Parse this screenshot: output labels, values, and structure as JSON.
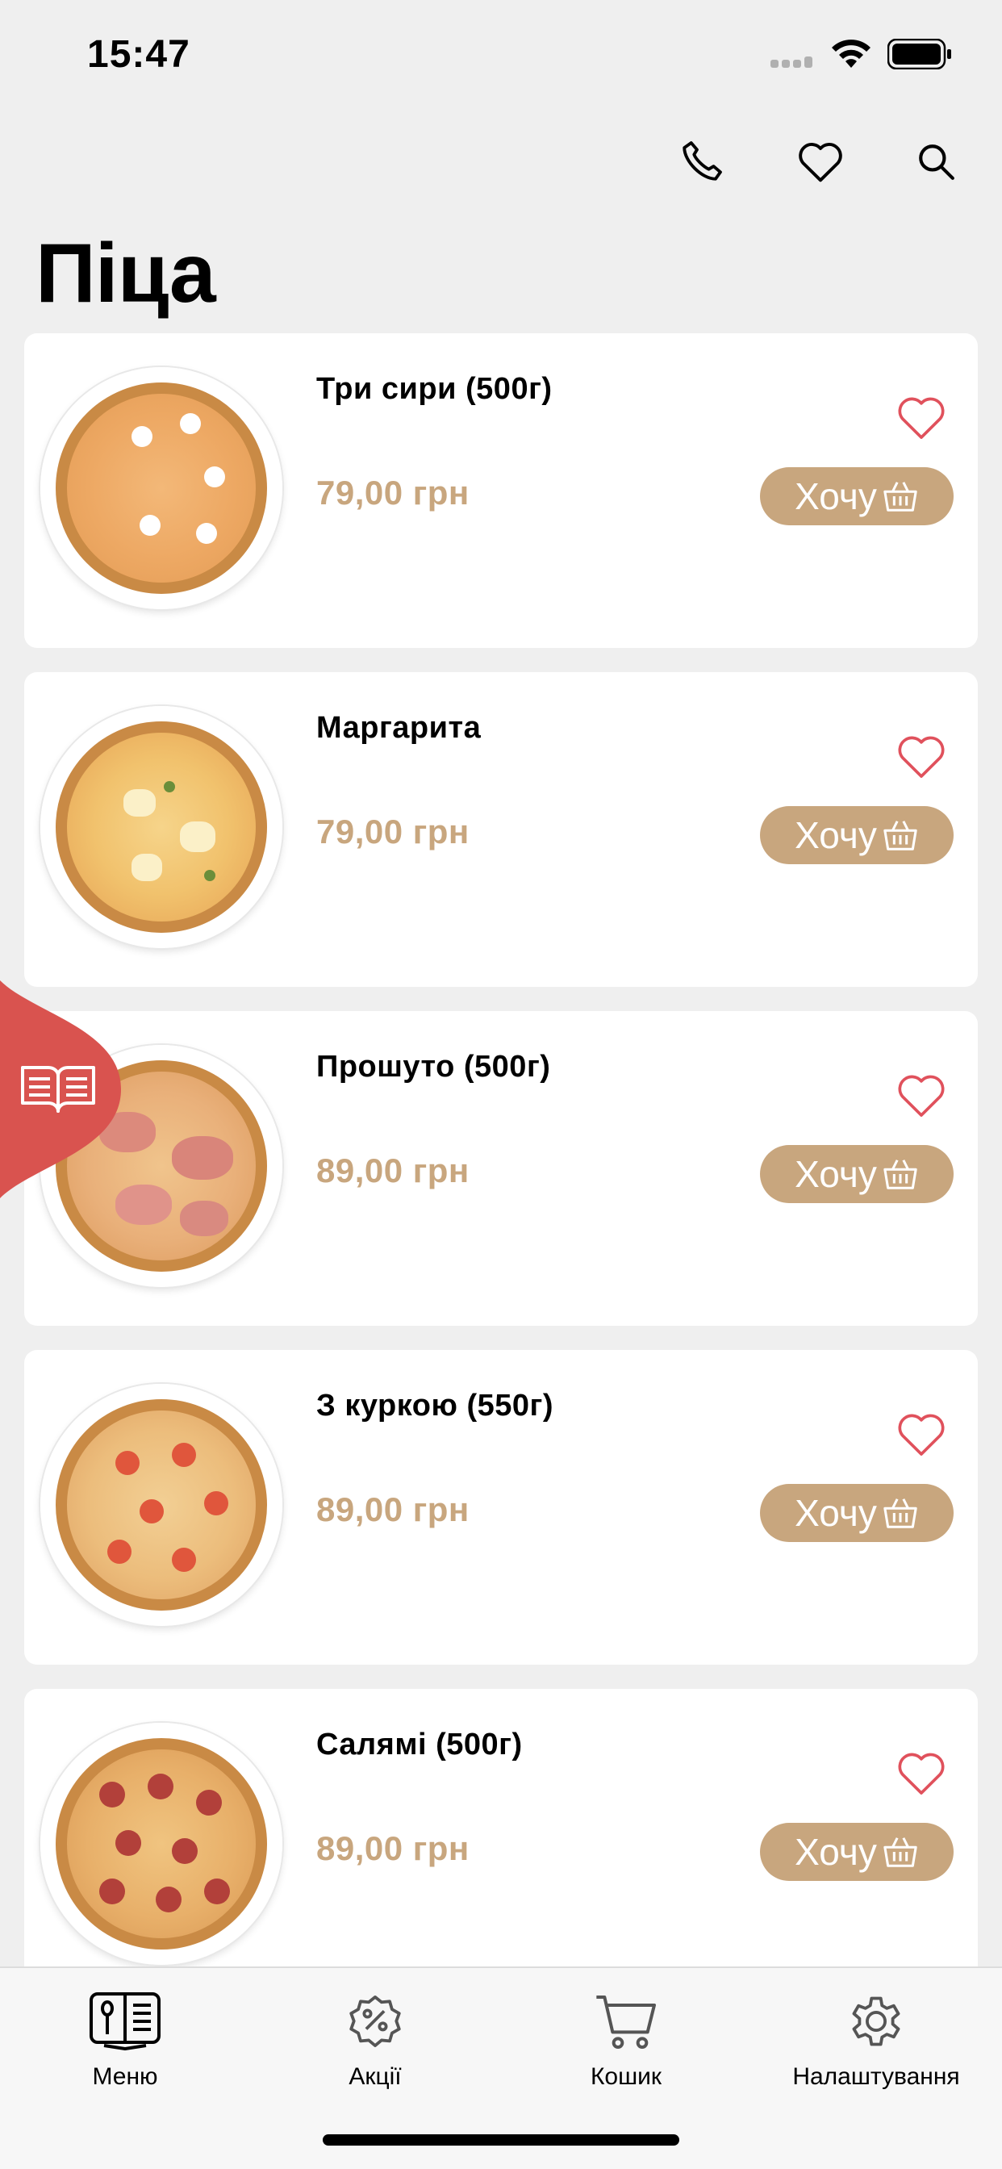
{
  "status_bar": {
    "time": "15:47"
  },
  "top_actions": {
    "icons": [
      "phone-icon",
      "heart-icon",
      "search-icon"
    ]
  },
  "page": {
    "title": "Піца"
  },
  "colors": {
    "accent": "#c8a67e",
    "heart": "#e0515c",
    "menu_bubble": "#d9534f",
    "background": "#efefef"
  },
  "products": [
    {
      "name": "Три сири (500г)",
      "price": "79,00 грн",
      "button_label": "Хочу"
    },
    {
      "name": "Маргарита",
      "price": "79,00 грн",
      "button_label": "Хочу"
    },
    {
      "name": "Прошуто (500г)",
      "price": "89,00 грн",
      "button_label": "Хочу"
    },
    {
      "name": "З куркою (550г)",
      "price": "89,00 грн",
      "button_label": "Хочу"
    },
    {
      "name": "Салямі (500г)",
      "price": "89,00 грн",
      "button_label": "Хочу"
    }
  ],
  "tab_bar": {
    "items": [
      {
        "label": "Меню",
        "icon": "menu-book-icon"
      },
      {
        "label": "Акції",
        "icon": "discount-badge-icon"
      },
      {
        "label": "Кошик",
        "icon": "cart-icon"
      },
      {
        "label": "Налаштування",
        "icon": "gear-icon"
      }
    ]
  }
}
